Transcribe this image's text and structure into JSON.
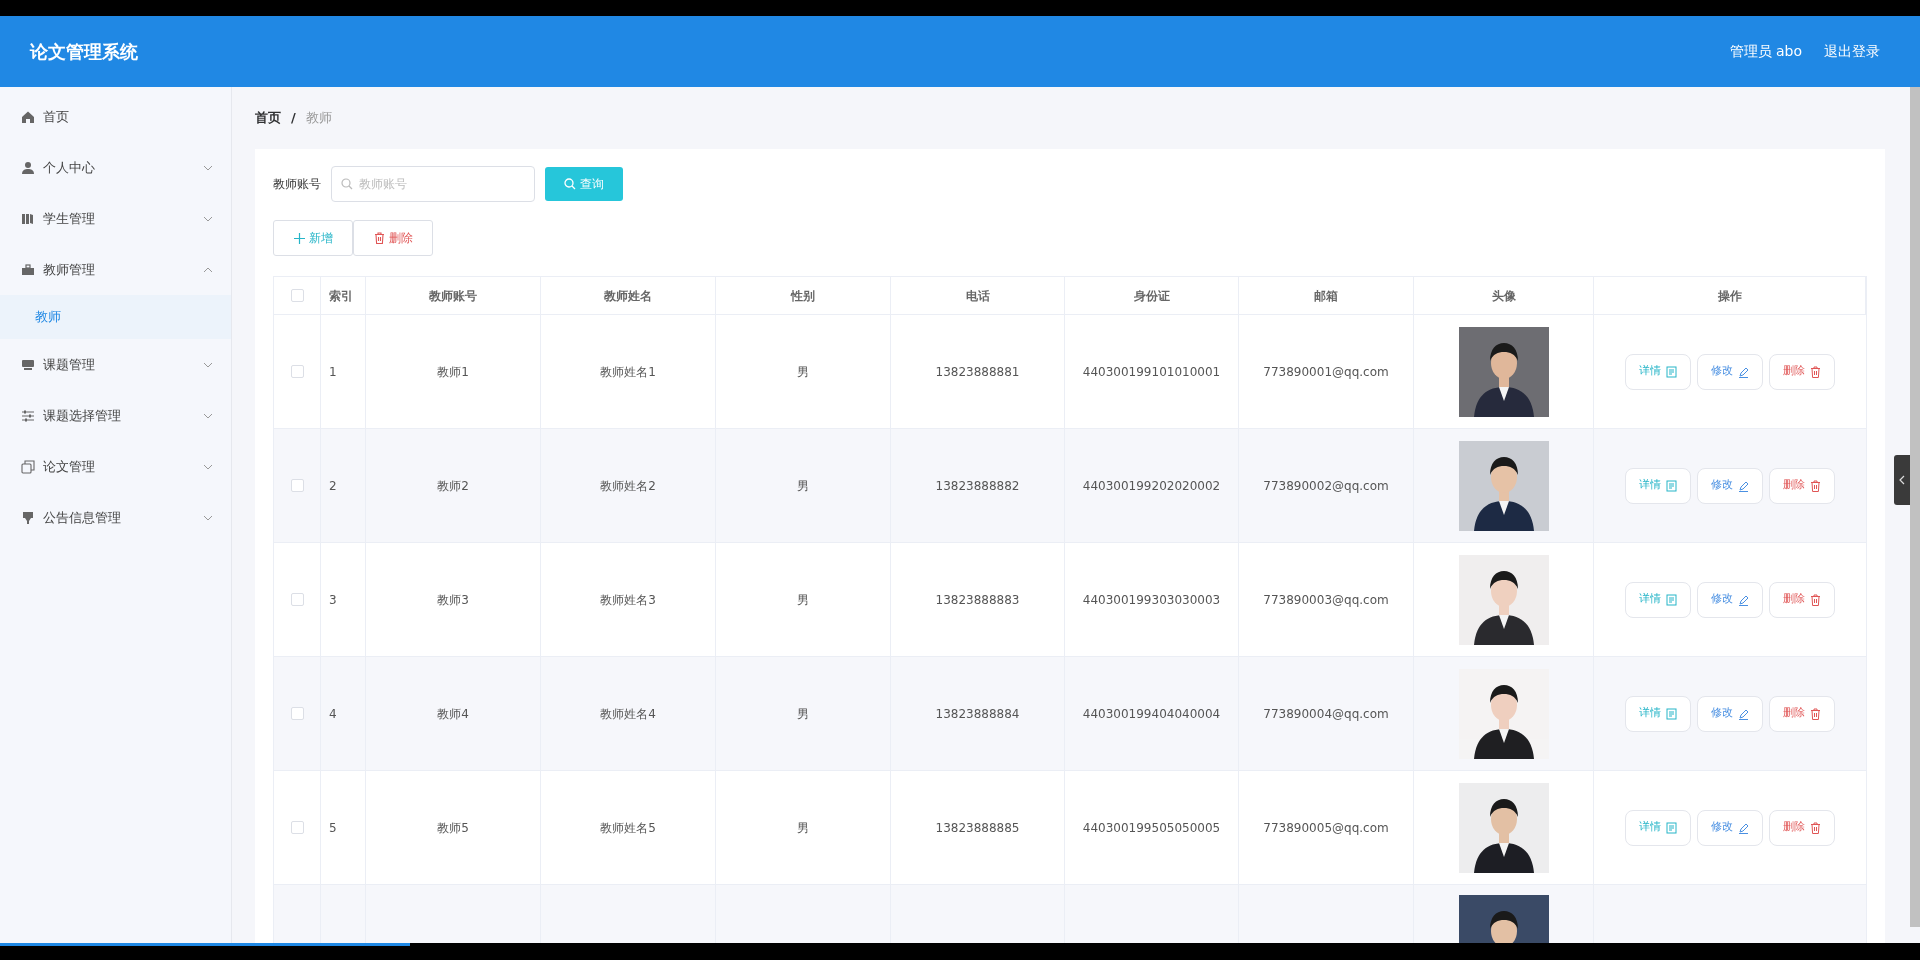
{
  "header": {
    "title": "论文管理系统",
    "user": "管理员 abo",
    "logout": "退出登录"
  },
  "sidebar": {
    "items": [
      {
        "kind": "link",
        "label": "首页"
      },
      {
        "kind": "menu",
        "label": "个人中心",
        "expanded": false
      },
      {
        "kind": "menu",
        "label": "学生管理",
        "expanded": false
      },
      {
        "kind": "menu",
        "label": "教师管理",
        "expanded": true,
        "children": [
          {
            "label": "教师",
            "selected": true
          }
        ]
      },
      {
        "kind": "menu",
        "label": "课题管理",
        "expanded": false
      },
      {
        "kind": "menu",
        "label": "课题选择管理",
        "expanded": false
      },
      {
        "kind": "menu",
        "label": "论文管理",
        "expanded": false
      },
      {
        "kind": "menu",
        "label": "公告信息管理",
        "expanded": false
      }
    ]
  },
  "breadcrumb": [
    "首页",
    "/",
    "教师"
  ],
  "search": {
    "label": "教师账号",
    "placeholder": "教师账号",
    "button": "查询"
  },
  "actions": {
    "add": "新增",
    "delete": "删除"
  },
  "table": {
    "select_all_checked": false,
    "columns": [
      "索引",
      "教师账号",
      "教师姓名",
      "性别",
      "电话",
      "身份证",
      "邮箱",
      "头像",
      "操作"
    ],
    "rows": [
      {
        "checked": false,
        "cells": [
          "1",
          "教师1",
          "教师姓名1",
          "男",
          "13823888881",
          "440300199101010001",
          "773890001@qq.com"
        ],
        "actions": [
          "详情",
          "修改",
          "删除"
        ]
      },
      {
        "checked": false,
        "cells": [
          "2",
          "教师2",
          "教师姓名2",
          "男",
          "13823888882",
          "440300199202020002",
          "773890002@qq.com"
        ],
        "actions": [
          "详情",
          "修改",
          "删除"
        ]
      },
      {
        "checked": false,
        "cells": [
          "3",
          "教师3",
          "教师姓名3",
          "男",
          "13823888883",
          "440300199303030003",
          "773890003@qq.com"
        ],
        "actions": [
          "详情",
          "修改",
          "删除"
        ]
      },
      {
        "checked": false,
        "cells": [
          "4",
          "教师4",
          "教师姓名4",
          "男",
          "13823888884",
          "440300199404040004",
          "773890004@qq.com"
        ],
        "actions": [
          "详情",
          "修改",
          "删除"
        ]
      },
      {
        "checked": false,
        "cells": [
          "5",
          "教师5",
          "教师姓名5",
          "男",
          "13823888885",
          "440300199505050005",
          "773890005@qq.com"
        ],
        "actions": [
          "详情",
          "修改",
          "删除"
        ]
      }
    ]
  }
}
